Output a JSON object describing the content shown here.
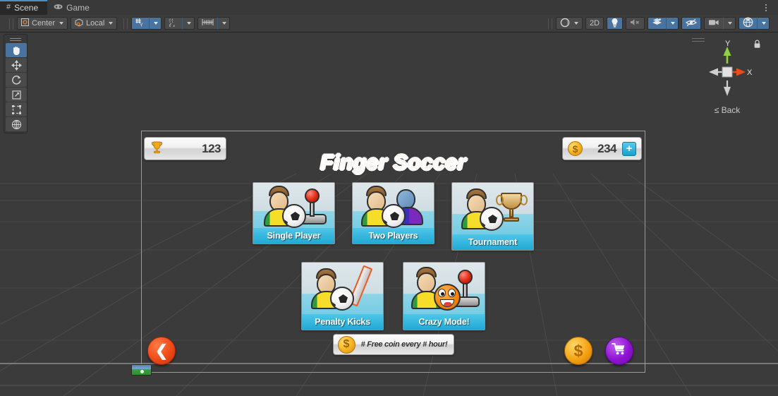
{
  "editor": {
    "tabs": [
      {
        "label": "Scene",
        "icon": "grid-icon",
        "active": true
      },
      {
        "label": "Game",
        "icon": "gamepad-icon",
        "active": false
      }
    ],
    "overflow_menu": "kebab-menu-icon",
    "toolbar": {
      "pivot_mode": "Center",
      "pivot_rotation": "Local",
      "grid_snap_label": "grid-snap-icon",
      "magnet_snap_label": "magnet-snap-icon",
      "ruler_label": "ruler-icon",
      "shading_label": "shading-mode-icon",
      "two_d_label": "2D",
      "lighting_label": "light-icon",
      "audio_label": "audio-mute-icon",
      "fx_label": "effects-icon",
      "hidden_label": "visibility-off-icon",
      "camera_label": "camera-icon",
      "gizmos_label": "gizmos-icon"
    },
    "tools": [
      {
        "name": "hand-tool",
        "glyph": "✋",
        "active": true
      },
      {
        "name": "move-tool",
        "glyph": "✥",
        "active": false
      },
      {
        "name": "rotate-tool",
        "glyph": "↻",
        "active": false
      },
      {
        "name": "scale-tool",
        "glyph": "⤢",
        "active": false
      },
      {
        "name": "rect-tool",
        "glyph": "⬚",
        "active": false
      },
      {
        "name": "transform-tool",
        "glyph": "✺",
        "active": false
      }
    ],
    "gizmo": {
      "axis_y": "Y",
      "axis_x": "X",
      "persp_label": "≤ Back",
      "lock_icon": "lock-icon"
    }
  },
  "game": {
    "title": "Finger Soccer",
    "trophy_count": "123",
    "coin_count": "234",
    "plus_label": "+",
    "free_coin_text": "# Free coin every # hour!",
    "menu_row1": [
      {
        "label": "Single Player",
        "art": "player-joystick"
      },
      {
        "label": "Two Players",
        "art": "two-players"
      },
      {
        "label": "Tournament",
        "art": "player-trophy"
      }
    ],
    "menu_row2": [
      {
        "label": "Penalty Kicks",
        "art": "player-ruler"
      },
      {
        "label": "Crazy Mode!",
        "art": "player-smiley"
      }
    ],
    "bottom_buttons": [
      {
        "name": "back-button",
        "glyph": "❮"
      },
      {
        "name": "coin-button",
        "glyph": "$"
      },
      {
        "name": "shop-button",
        "glyph": "🛒"
      }
    ],
    "colors": {
      "title_orange": "#ff6a00",
      "label_cyan": "#21a9d4",
      "back_red": "#ef4a18",
      "shop_purple": "#9013d4",
      "coin_gold": "#f5a312"
    }
  }
}
